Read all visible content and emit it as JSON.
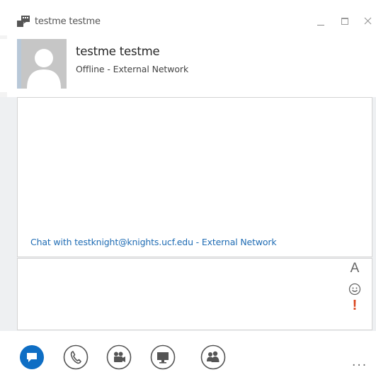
{
  "window": {
    "title": "testme testme",
    "app_icon": "lync-chat-icon",
    "controls": [
      "minimize-icon",
      "maximize-icon",
      "close-icon"
    ]
  },
  "contact": {
    "name": "testme testme",
    "status": "Offline - External Network",
    "avatar": "default-person-avatar"
  },
  "conversation": {
    "notice": "Chat with testknight@knights.ucf.edu - External Network"
  },
  "compose": {
    "value": "",
    "tools": {
      "font": "A",
      "emoticon": "smiley-icon",
      "priority": "!"
    }
  },
  "actions": [
    {
      "name": "im-button",
      "icon": "speech-bubble-icon",
      "active": true
    },
    {
      "name": "call-button",
      "icon": "phone-icon",
      "active": false
    },
    {
      "name": "video-button",
      "icon": "video-camera-icon",
      "active": false
    },
    {
      "name": "present-button",
      "icon": "monitor-icon",
      "active": false
    },
    {
      "name": "people-button",
      "icon": "people-icon",
      "active": false
    }
  ],
  "more_label": "...",
  "colors": {
    "accent": "#1f6cb4",
    "im_active": "#0f6ec4",
    "icon_gray": "#555555",
    "priority": "#d9431b",
    "panel_bg": "#eef0f2"
  }
}
